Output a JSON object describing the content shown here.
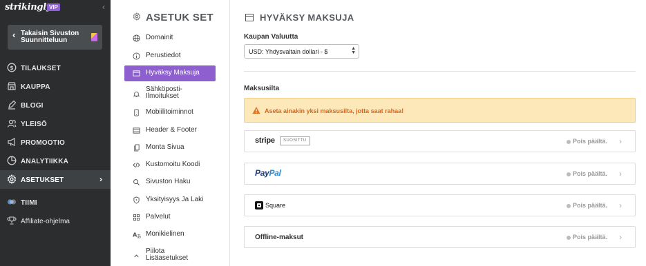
{
  "brand": {
    "logo": "strikingly",
    "vip_badge": "VIP",
    "collapse_icon": "chevron-left-icon"
  },
  "back_button": {
    "label": "Takaisin Sivuston Suunnitteluun"
  },
  "nav": {
    "items": [
      {
        "label": "TILAUKSET",
        "icon": "dollar-circle-icon"
      },
      {
        "label": "KAUPPA",
        "icon": "store-icon"
      },
      {
        "label": "BLOGI",
        "icon": "pen-icon"
      },
      {
        "label": "YLEISÖ",
        "icon": "audience-icon"
      },
      {
        "label": "PROMOOTIO",
        "icon": "megaphone-icon"
      },
      {
        "label": "ANALYTIIKKA",
        "icon": "pie-chart-icon"
      },
      {
        "label": "ASETUKSET",
        "icon": "gear-icon",
        "active": true
      },
      {
        "label": "TIIMI",
        "icon": "team-icon"
      },
      {
        "label": "Affiliate-ohjelma",
        "icon": "trophy-icon"
      }
    ]
  },
  "settings": {
    "title": "ASETUK SET",
    "items": [
      {
        "label": "Domainit",
        "icon": "globe-icon"
      },
      {
        "label": "Perustiedot",
        "icon": "info-icon"
      },
      {
        "label": "Hyväksy Maksuja",
        "icon": "card-icon",
        "active": true
      },
      {
        "label": "Sähköposti-\nIlmoitukset",
        "label_line1": "Sähköposti-",
        "label_line2": "Ilmoitukset",
        "icon": "bell-icon"
      },
      {
        "label": "Mobiilitoiminnot",
        "icon": "mobile-icon"
      },
      {
        "label": "Header & Footer",
        "icon": "layout-icon"
      },
      {
        "label": "Monta Sivua",
        "icon": "pages-icon"
      },
      {
        "label": "Kustomoitu Koodi",
        "icon": "code-icon"
      },
      {
        "label": "Sivuston Haku",
        "icon": "search-icon"
      },
      {
        "label": "Yksityisyys Ja Laki",
        "icon": "shield-icon"
      },
      {
        "label": "Palvelut",
        "icon": "grid-icon"
      },
      {
        "label": "Monikielinen",
        "icon": "translate-icon"
      },
      {
        "label_line1": "Piilota",
        "label_line2": "Lisäasetukset",
        "icon": "chevron-up-icon"
      }
    ]
  },
  "main": {
    "title": "HYVÄKSY MAKSUJA",
    "currency_label": "Kaupan Valuutta",
    "currency_value": "USD: Yhdysvaltain dollari - $",
    "gateways_label": "Maksusilta",
    "alert_text": "Aseta ainakin yksi maksusilta, jotta saat rahaa!",
    "gateways": [
      {
        "name": "stripe",
        "badge": "SUOSITTU",
        "status": "Pois päältä."
      },
      {
        "name_part1": "Pay",
        "name_part2": "Pal",
        "status": "Pois päältä."
      },
      {
        "name": "Square",
        "status": "Pois päältä."
      },
      {
        "name": "Offline-maksut",
        "status": "Pois päältä."
      }
    ]
  },
  "colors": {
    "sidebar_bg": "#2b2d2f",
    "accent": "#8e5fcf",
    "alert_bg": "#fde8b9",
    "alert_text": "#d9661f"
  }
}
